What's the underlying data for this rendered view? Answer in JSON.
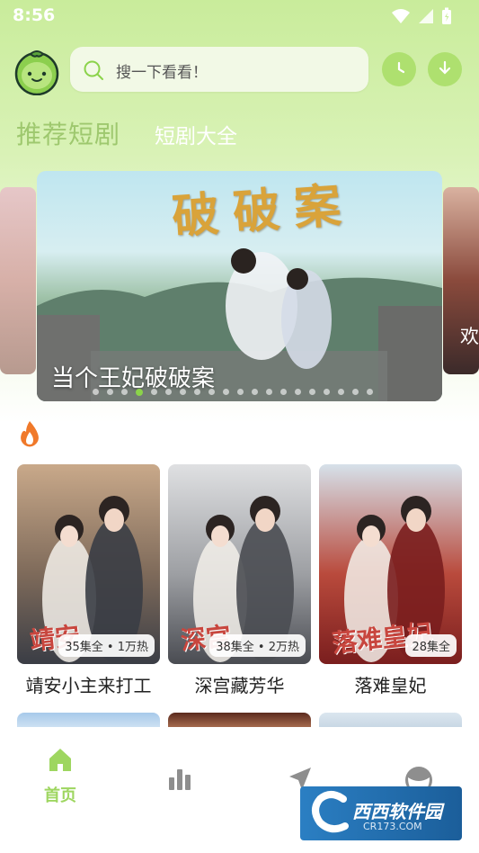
{
  "status_bar": {
    "time": "8:56"
  },
  "search": {
    "placeholder": "搜一下看看！"
  },
  "tabs": {
    "main": "推荐短剧",
    "sub": "短剧大全"
  },
  "carousel": {
    "banner_title": "当个王妃破破案",
    "banner_art_text": "破破案",
    "right_peek_text": "欢",
    "dot_count": 20,
    "active_dot": 3
  },
  "dramas": [
    {
      "title": "靖安小主来打工",
      "badge": "35集全 • 1万热",
      "art_text": "靖安",
      "colors": [
        "#c9a98a",
        "#7e6a5a",
        "#3a3d45"
      ]
    },
    {
      "title": "深宫藏芳华",
      "badge": "38集全 • 2万热",
      "art_text": "深宫",
      "colors": [
        "#dfe0e2",
        "#9d9fa3",
        "#4a4c52"
      ]
    },
    {
      "title": "落难皇妃",
      "badge": "28集全",
      "art_text": "落难皇妃",
      "colors": [
        "#d6e1ea",
        "#b94a3c",
        "#7a1e1e"
      ]
    }
  ],
  "tabbar": {
    "home_label": "首页"
  },
  "watermark": {
    "text": "西西软件园",
    "sub": "CR173.COM"
  },
  "colors": {
    "accent": "#9ed660",
    "search_bg": "#f2f9e6"
  }
}
